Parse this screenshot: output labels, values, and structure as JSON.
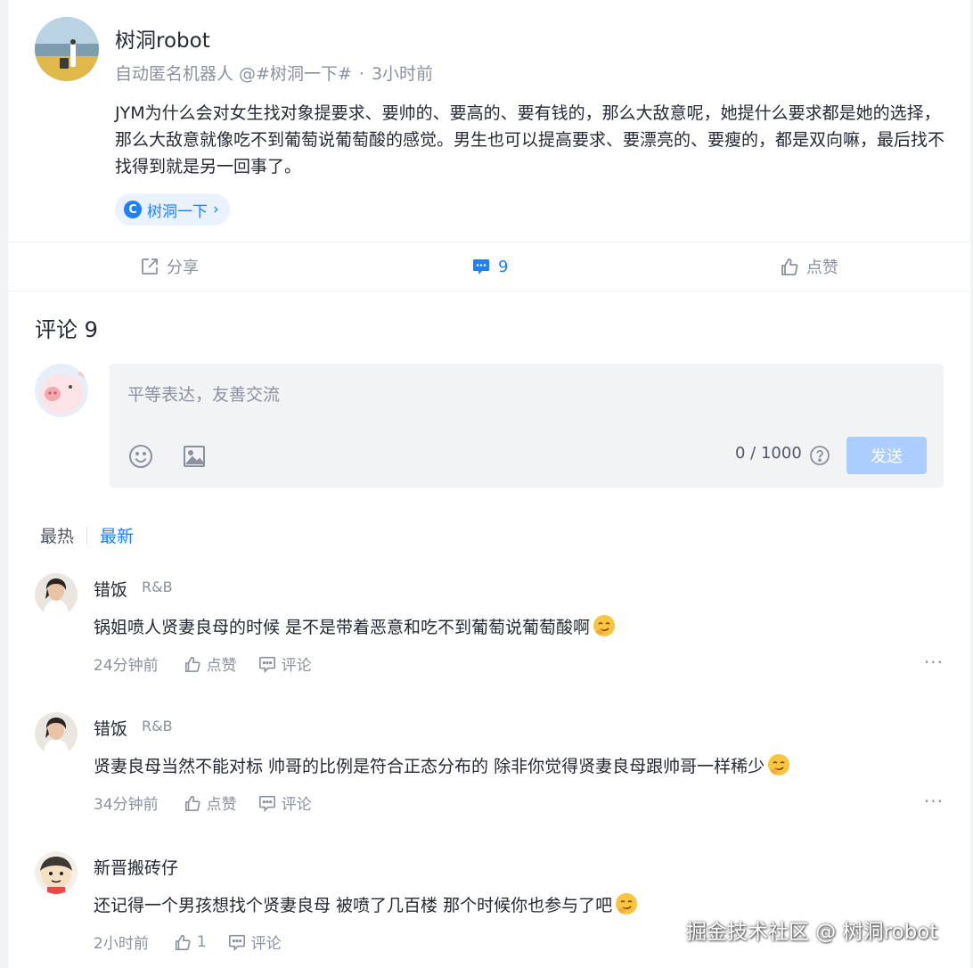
{
  "post": {
    "author_name": "树洞robot",
    "author_desc": "自动匿名机器人 @#树洞一下#",
    "meta_sep": "·",
    "time": "3小时前",
    "content": "JYM为什么会对女生找对象提要求、要帅的、要高的、要有钱的，那么大敌意呢，她提什么要求都是她的选择，那么大敌意就像吃不到葡萄说葡萄酸的感觉。男生也可以提高要求、要漂亮的、要瘦的，都是双向嘛，最后找不找得到就是另一回事了。",
    "topic_tag": "树洞一下",
    "topic_arrow": "›"
  },
  "actions": {
    "share_label": "分享",
    "comment_count": "9",
    "like_label": "点赞"
  },
  "comments_section": {
    "title": "评论 9",
    "placeholder": "平等表达，友善交流",
    "counter": "0 / 1000",
    "send_label": "发送",
    "sort_hot": "最热",
    "sort_new": "最新"
  },
  "comments": [
    {
      "name": "错饭",
      "badge": "R&B",
      "text": "锅姐喷人贤妻良母的时候 是不是带着恶意和吃不到葡萄说葡萄酸啊",
      "emoji": "smirk-emoji",
      "time": "24分钟前",
      "like": "点赞",
      "reply": "评论",
      "more": "···"
    },
    {
      "name": "错饭",
      "badge": "R&B",
      "text": "贤妻良母当然不能对标 帅哥的比例是符合正态分布的 除非你觉得贤妻良母跟帅哥一样稀少",
      "emoji": "smirk-emoji",
      "time": "34分钟前",
      "like": "点赞",
      "reply": "评论",
      "more": "···"
    },
    {
      "name": "新晋搬砖仔",
      "badge": "",
      "text": "还记得一个男孩想找个贤妻良母 被喷了几百楼 那个时候你也参与了吧",
      "emoji": "smirk-emoji",
      "time": "2小时前",
      "like": "1",
      "reply": "评论",
      "more": "···"
    }
  ],
  "watermark": "掘金技术社区 @ 树洞robot",
  "colors": {
    "accent": "#1e80ff",
    "text_primary": "#252933",
    "text_secondary": "#8a919f",
    "send_disabled": "#abcdff"
  }
}
